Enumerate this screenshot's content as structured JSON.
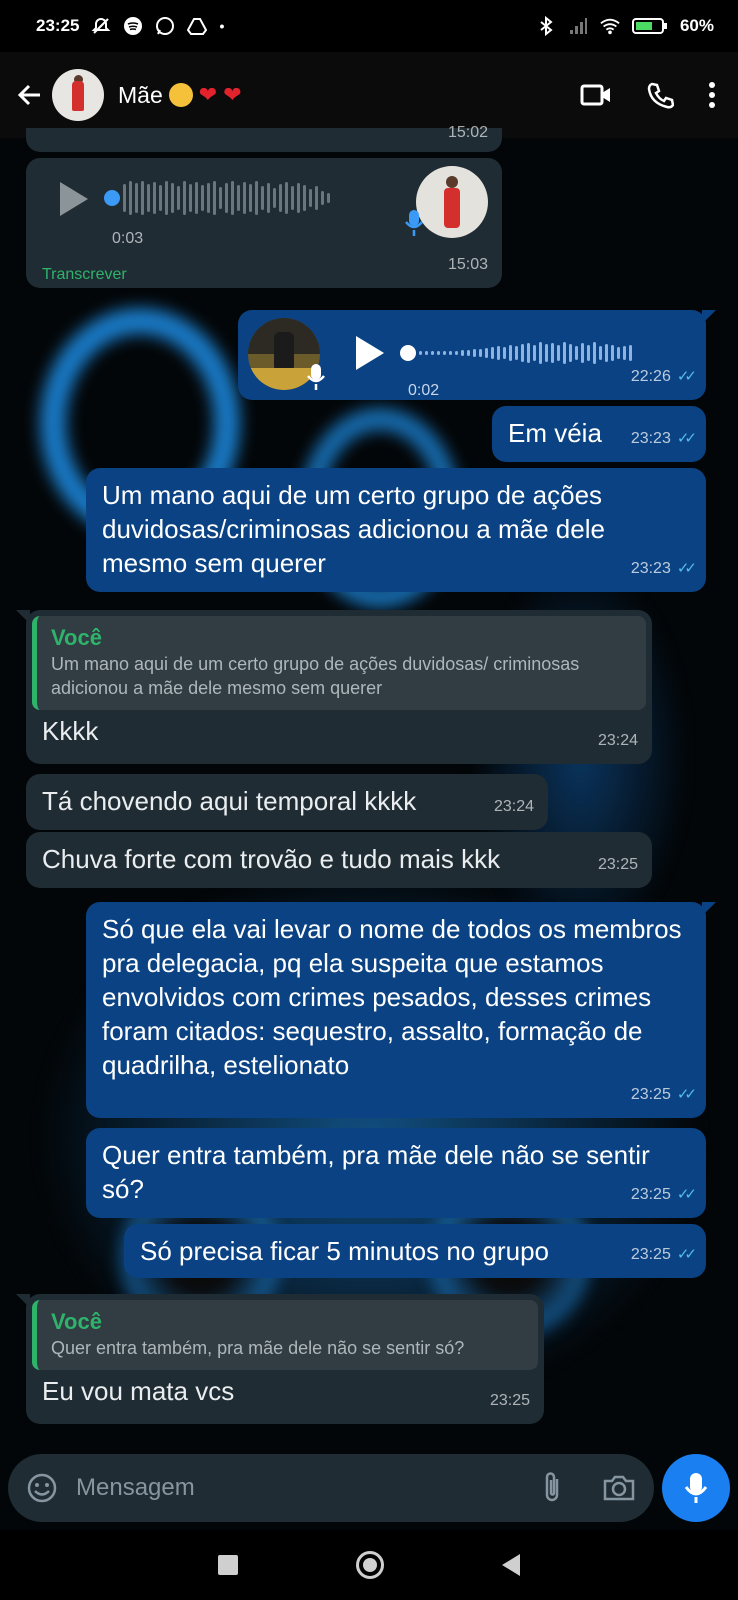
{
  "status_bar": {
    "time": "23:25",
    "battery": "60%",
    "icons": [
      "muted-icon",
      "spotify-icon",
      "whatsapp-icon",
      "drive-icon",
      "dot-icon",
      "bluetooth-icon",
      "signal-icon",
      "wifi-icon",
      "battery-icon"
    ]
  },
  "header": {
    "contact_name": "Mãe",
    "icons": [
      "back-arrow-icon",
      "video-call-icon",
      "phone-icon",
      "more-options-icon"
    ]
  },
  "messages": {
    "m0": {
      "type": "audio",
      "direction": "in",
      "time_partial": "15:02"
    },
    "m1": {
      "type": "audio",
      "direction": "in",
      "duration": "0:03",
      "action": "Transcrever",
      "time": "15:03"
    },
    "m2": {
      "type": "audio",
      "direction": "out",
      "duration": "0:02",
      "time": "22:26",
      "read": true
    },
    "m3": {
      "type": "text",
      "direction": "out",
      "text": "Em véia",
      "time": "23:23",
      "read": true
    },
    "m4": {
      "type": "text",
      "direction": "out",
      "text": "Um mano aqui de um certo grupo de ações duvidosas/criminosas adicionou a mãe dele mesmo sem querer",
      "time": "23:23",
      "read": true
    },
    "m5": {
      "type": "reply",
      "direction": "in",
      "quote_author": "Você",
      "quote_text": "Um mano aqui de um certo grupo de ações duvidosas/ criminosas adicionou a mãe dele mesmo sem querer",
      "text": "Kkkk",
      "time": "23:24"
    },
    "m6": {
      "type": "text",
      "direction": "in",
      "text": "Tá chovendo aqui temporal kkkk",
      "time": "23:24"
    },
    "m7": {
      "type": "text",
      "direction": "in",
      "text": "Chuva forte com trovão e tudo mais kkk",
      "time": "23:25"
    },
    "m8": {
      "type": "text",
      "direction": "out",
      "text": "Só que ela vai levar o nome de todos os membros pra delegacia, pq ela suspeita que estamos envolvidos com crimes pesados, desses crimes foram citados: sequestro, assalto, formação de quadrilha, estelionato",
      "time": "23:25",
      "read": true
    },
    "m9": {
      "type": "text",
      "direction": "out",
      "text": "Quer entra também, pra mãe dele não se sentir só?",
      "time": "23:25",
      "read": true
    },
    "m10": {
      "type": "text",
      "direction": "out",
      "text": "Só precisa ficar 5 minutos no grupo",
      "time": "23:25",
      "read": true
    },
    "m11": {
      "type": "reply",
      "direction": "in",
      "quote_author": "Você",
      "quote_text": "Quer entra também, pra mãe dele não se sentir só?",
      "text": "Eu vou mata vcs",
      "time": "23:25"
    }
  },
  "input": {
    "placeholder": "Mensagem",
    "icons": [
      "emoji-icon",
      "attach-icon",
      "camera-icon",
      "mic-icon"
    ]
  },
  "nav": {
    "icons": [
      "recents-square-icon",
      "home-circle-icon",
      "back-triangle-icon"
    ]
  },
  "colors": {
    "incoming_bubble": "#202c33",
    "outgoing_bubble": "#0a4283",
    "quote_accent": "#2fb36b",
    "read_ticks": "#53bdeb",
    "mic_button": "#1a7ff0",
    "wallpaper_glow": "#1e9bff"
  }
}
